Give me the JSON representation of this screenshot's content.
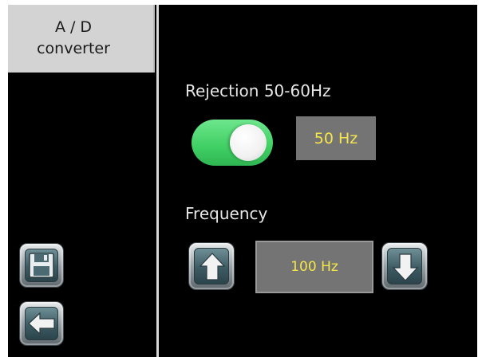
{
  "sidebar": {
    "tab": {
      "line1": "A / D",
      "line2": "converter"
    },
    "buttons": [
      {
        "icon": "save-icon"
      },
      {
        "icon": "back-arrow-icon"
      }
    ]
  },
  "rejection": {
    "label": "Rejection 50-60Hz",
    "toggle_on": true,
    "value": "50 Hz"
  },
  "frequency": {
    "label": "Frequency",
    "value": "100 Hz",
    "up_icon": "arrow-up-icon",
    "down_icon": "arrow-down-icon"
  },
  "colors": {
    "toggle_on": "#3fcf63",
    "value_text": "#f5e64a",
    "value_bg": "#747474",
    "tab_bg": "#d3d3d3"
  }
}
